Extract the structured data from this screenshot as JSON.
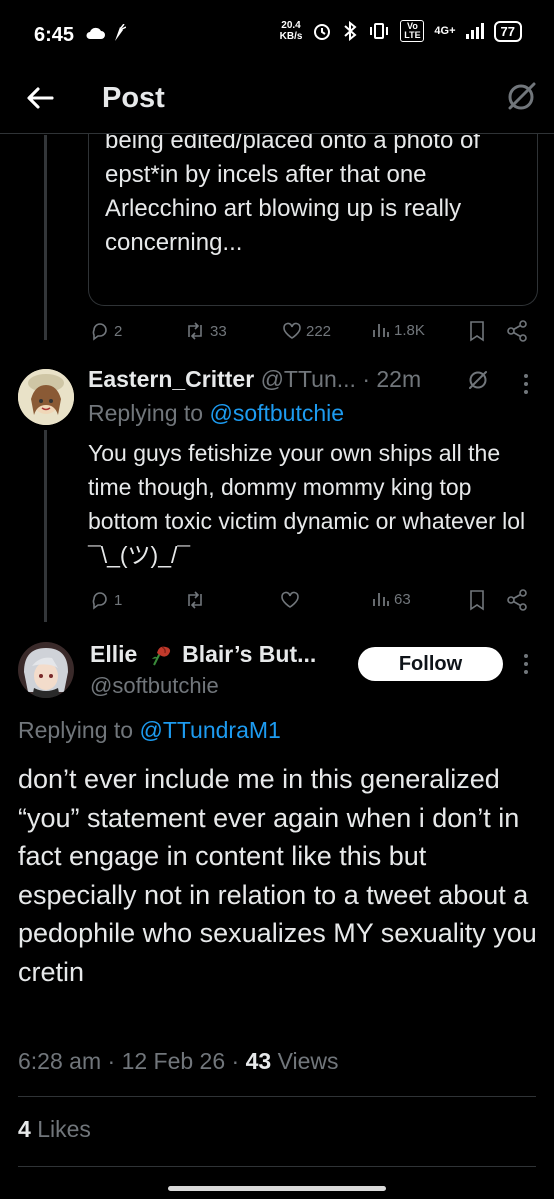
{
  "status_bar": {
    "time": "6:45",
    "speed_value": "20.4",
    "speed_unit": "KB/s",
    "network": "4G+",
    "volte": "Vo LTE",
    "battery": "77"
  },
  "header": {
    "title": "Post"
  },
  "quoted_tweet": {
    "text": "The increase of lesbian and yuri stuff being edited/placed onto a photo of epst*in by incels after that one Arlecchino art blowing up is really concerning...",
    "replies": "2",
    "reposts": "33",
    "likes": "222",
    "views": "1.8K"
  },
  "reply1": {
    "display_name": "Eastern_Critter",
    "handle": "@TTun...",
    "time": "· 22m",
    "replying_prefix": "Replying to ",
    "replying_to": "@softbutchie",
    "text": "You guys fetishize your own ships all the time though, dommy mommy king top bottom toxic victim dynamic or whatever lol ¯\\_(ツ)_/¯",
    "replies": "1",
    "views": "63"
  },
  "main_tweet": {
    "display_name_a": "Ellie",
    "display_name_b": "Blair’s But...",
    "handle": "@softbutchie",
    "follow_label": "Follow",
    "replying_prefix": "Replying to ",
    "replying_to": "@TTundraM1",
    "text": "don’t ever include me in this generalized “you” statement ever again when i don’t in fact engage in content like this but especially not in relation to a tweet about a pedophile who sexualizes MY sexuality you cretin",
    "time": "6:28 am",
    "date": "12 Feb 26",
    "views_count": "43",
    "views_label": "Views",
    "likes_count": "4",
    "likes_label": "Likes"
  },
  "colors": {
    "background": "#000000",
    "text": "#e7e9ea",
    "muted": "#71767b",
    "link": "#1d9bf0",
    "border": "#2f3336"
  }
}
